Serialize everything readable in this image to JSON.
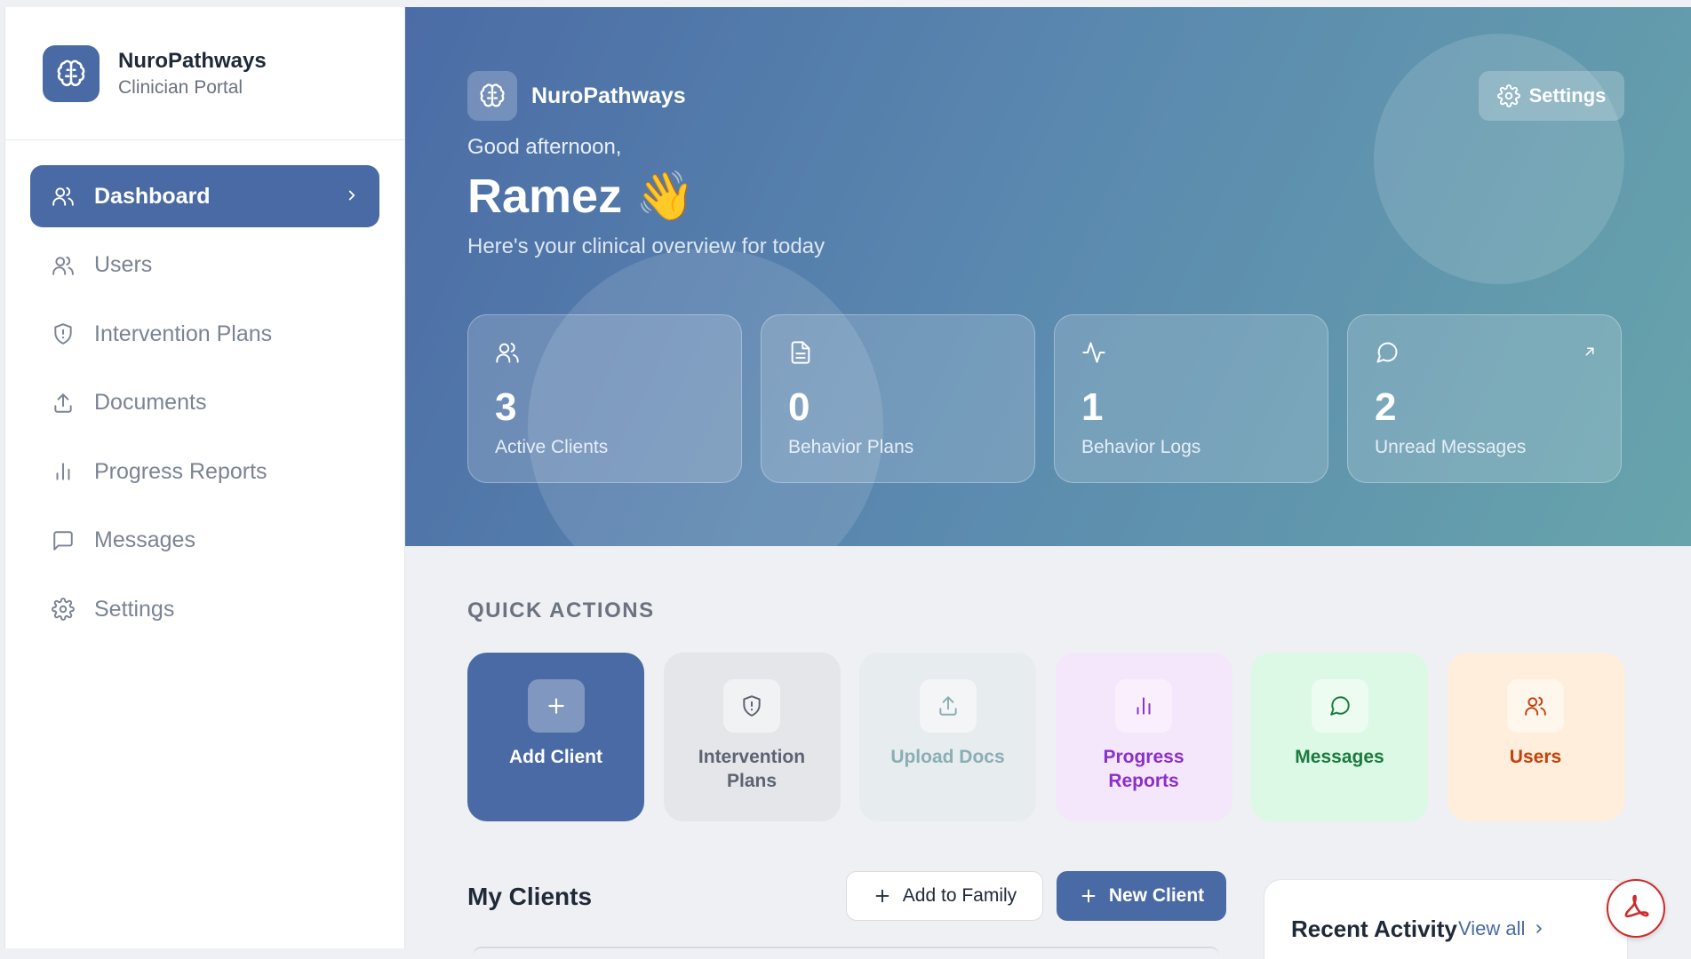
{
  "sidebar": {
    "brand": {
      "name": "NuroPathways",
      "subtitle": "Clinician Portal",
      "icon": "brain-icon"
    },
    "items": [
      {
        "label": "Dashboard",
        "icon": "users-icon",
        "active": true
      },
      {
        "label": "Users",
        "icon": "users-icon"
      },
      {
        "label": "Intervention Plans",
        "icon": "shield-icon"
      },
      {
        "label": "Documents",
        "icon": "upload-icon"
      },
      {
        "label": "Progress Reports",
        "icon": "bar-chart-icon"
      },
      {
        "label": "Messages",
        "icon": "message-square-icon"
      },
      {
        "label": "Settings",
        "icon": "gear-icon"
      }
    ]
  },
  "hero": {
    "brand_name": "NuroPathways",
    "settings_label": "Settings",
    "greeting": "Good afternoon,",
    "user_name": "Ramez 👋",
    "overview": "Here's your clinical overview for today",
    "stats": [
      {
        "value": "3",
        "label": "Active Clients",
        "icon": "users-icon"
      },
      {
        "value": "0",
        "label": "Behavior Plans",
        "icon": "document-icon"
      },
      {
        "value": "1",
        "label": "Behavior Logs",
        "icon": "activity-icon"
      },
      {
        "value": "2",
        "label": "Unread Messages",
        "icon": "message-circle-icon",
        "corner_icon": "arrow-up-right-icon"
      }
    ]
  },
  "quick_actions": {
    "title": "QUICK ACTIONS",
    "items": [
      {
        "label": "Add Client",
        "icon": "plus-icon"
      },
      {
        "label": "Intervention Plans",
        "icon": "shield-icon"
      },
      {
        "label": "Upload Docs",
        "icon": "upload-icon"
      },
      {
        "label": "Progress Reports",
        "icon": "bar-chart-icon"
      },
      {
        "label": "Messages",
        "icon": "message-circle-icon"
      },
      {
        "label": "Users",
        "icon": "users-icon"
      }
    ]
  },
  "clients": {
    "title": "My Clients",
    "add_family_label": "Add to Family",
    "new_client_label": "New Client"
  },
  "activity": {
    "title": "Recent Activity",
    "view_all_label": "View all"
  },
  "colors": {
    "primary": "#4a6aa5",
    "hero_start": "#4b6ca6",
    "hero_end": "#67a4ab",
    "pdf_red": "#cc2b2b"
  }
}
